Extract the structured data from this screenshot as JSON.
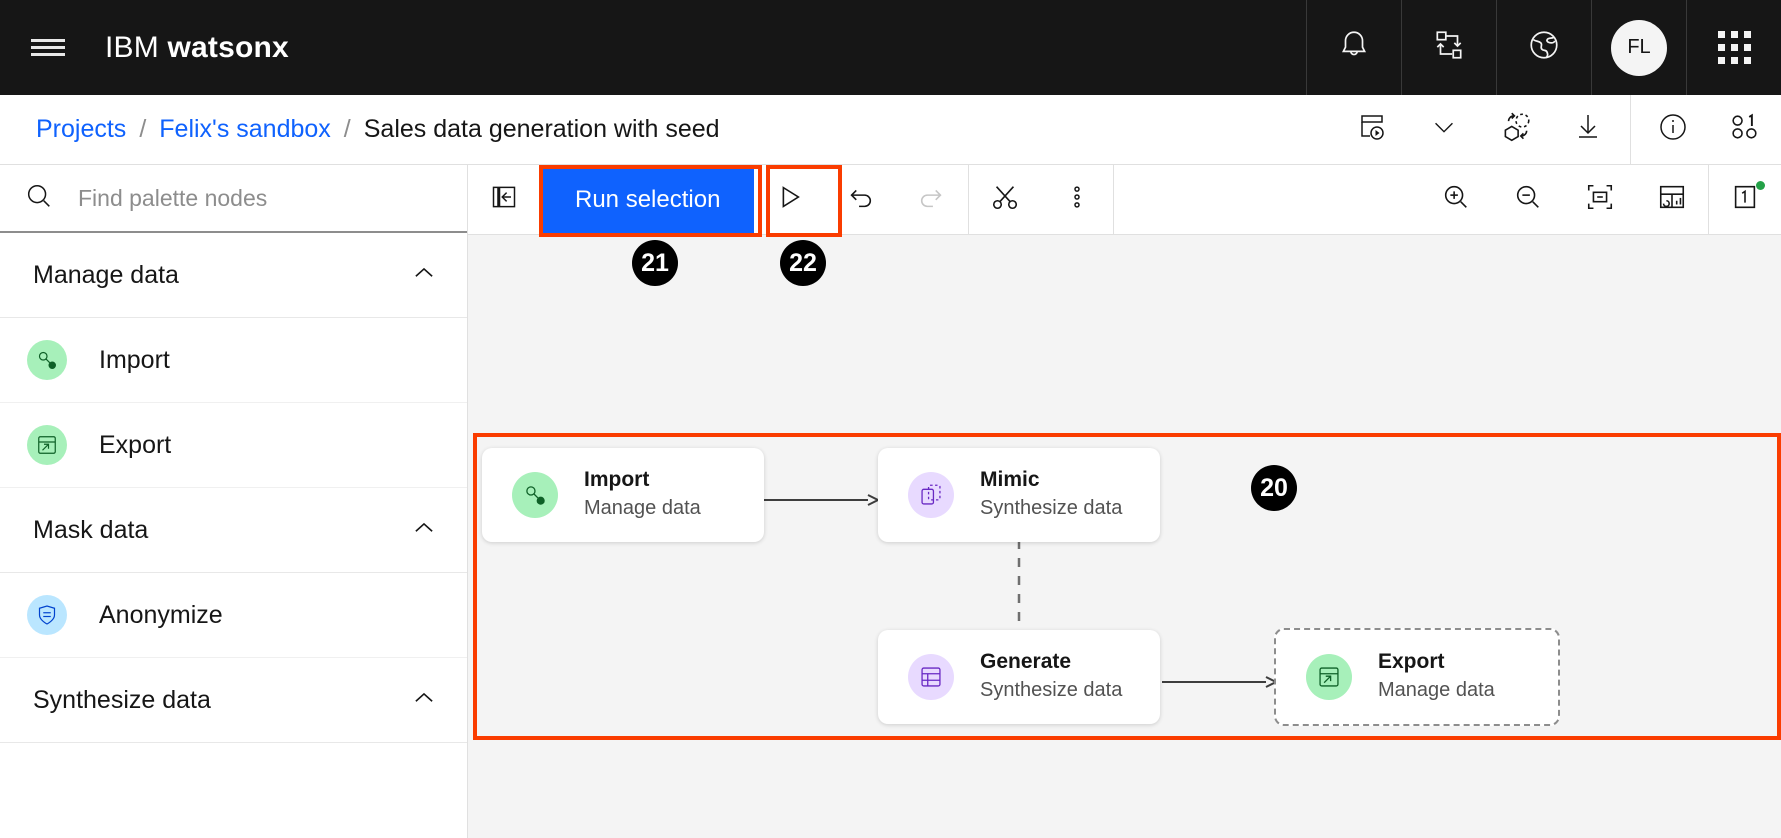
{
  "header": {
    "menu_icon": "hamburger-menu-icon",
    "brand_light": "IBM",
    "brand_bold": "watsonx",
    "actions": [
      {
        "name": "notifications",
        "icon": "bell-icon"
      },
      {
        "name": "jobs",
        "icon": "flow-data-icon"
      },
      {
        "name": "region",
        "icon": "globe-icon"
      },
      {
        "name": "profile",
        "icon": "avatar",
        "initials": "FL"
      },
      {
        "name": "app-switcher",
        "icon": "grid-icon"
      }
    ]
  },
  "breadcrumb": {
    "items": [
      {
        "label": "Projects",
        "type": "link"
      },
      {
        "label": "Felix's sandbox",
        "type": "link"
      },
      {
        "label": "Sales data generation with seed",
        "type": "current"
      }
    ],
    "separator": "/",
    "actions": [
      {
        "name": "run-history-button",
        "icon": "run-history-icon"
      },
      {
        "name": "run-history-dropdown",
        "icon": "chevron-down-icon"
      },
      {
        "name": "model-button",
        "icon": "cube-refresh-icon"
      },
      {
        "name": "download-button",
        "icon": "download-icon"
      },
      {
        "name": "info-button",
        "icon": "information-icon"
      },
      {
        "name": "collaborators-button",
        "icon": "binary-users-icon"
      }
    ]
  },
  "palette": {
    "search": {
      "placeholder": "Find palette nodes",
      "value": "",
      "icon": "search-icon"
    },
    "sections": [
      {
        "label": "Manage data",
        "expanded": true,
        "nodes": [
          {
            "label": "Import",
            "icon": "import-node-icon",
            "color": "green"
          },
          {
            "label": "Export",
            "icon": "export-node-icon",
            "color": "green"
          }
        ]
      },
      {
        "label": "Mask data",
        "expanded": true,
        "nodes": [
          {
            "label": "Anonymize",
            "icon": "anonymize-shield-icon",
            "color": "blue"
          }
        ]
      },
      {
        "label": "Synthesize data",
        "expanded": true,
        "nodes": []
      }
    ]
  },
  "toolbar": {
    "collapse_panel": {
      "label": "",
      "icon": "collapse-panel-icon"
    },
    "run_selection_label": "Run selection",
    "run_all": {
      "icon": "play-icon"
    },
    "undo": {
      "icon": "undo-icon",
      "enabled": true
    },
    "redo": {
      "icon": "redo-icon",
      "enabled": false
    },
    "cut": {
      "icon": "scissors-icon"
    },
    "overflow": {
      "icon": "overflow-menu-icon"
    },
    "zoom_in": {
      "icon": "zoom-in-icon"
    },
    "zoom_out": {
      "icon": "zoom-out-icon"
    },
    "fit_to_screen": {
      "icon": "fit-to-screen-icon"
    },
    "data_preview": {
      "icon": "table-split-icon"
    },
    "notebook": {
      "icon": "page-number-icon",
      "badge": "1",
      "badge_color": "#24a148"
    }
  },
  "canvas": {
    "nodes": [
      {
        "id": "import",
        "title": "Import",
        "subtitle": "Manage data",
        "icon": "import-node-icon",
        "color": "green",
        "selected": false
      },
      {
        "id": "mimic",
        "title": "Mimic",
        "subtitle": "Synthesize data",
        "icon": "mimic-node-icon",
        "color": "purple",
        "selected": false
      },
      {
        "id": "generate",
        "title": "Generate",
        "subtitle": "Synthesize data",
        "icon": "generate-node-icon",
        "color": "purple",
        "selected": false
      },
      {
        "id": "export",
        "title": "Export",
        "subtitle": "Manage data",
        "icon": "export-node-icon",
        "color": "green",
        "selected": true
      }
    ],
    "links": [
      {
        "from": "import",
        "to": "mimic",
        "style": "solid"
      },
      {
        "from": "mimic",
        "to": "generate",
        "style": "dashed"
      },
      {
        "from": "generate",
        "to": "export",
        "style": "solid"
      }
    ]
  },
  "annotations": {
    "accent_color": "#fa3c00",
    "badges": [
      {
        "id": "20",
        "label": "20",
        "target": "canvas-flow-region"
      },
      {
        "id": "21",
        "label": "21",
        "target": "run-selection-button"
      },
      {
        "id": "22",
        "label": "22",
        "target": "run-all-button"
      }
    ]
  }
}
